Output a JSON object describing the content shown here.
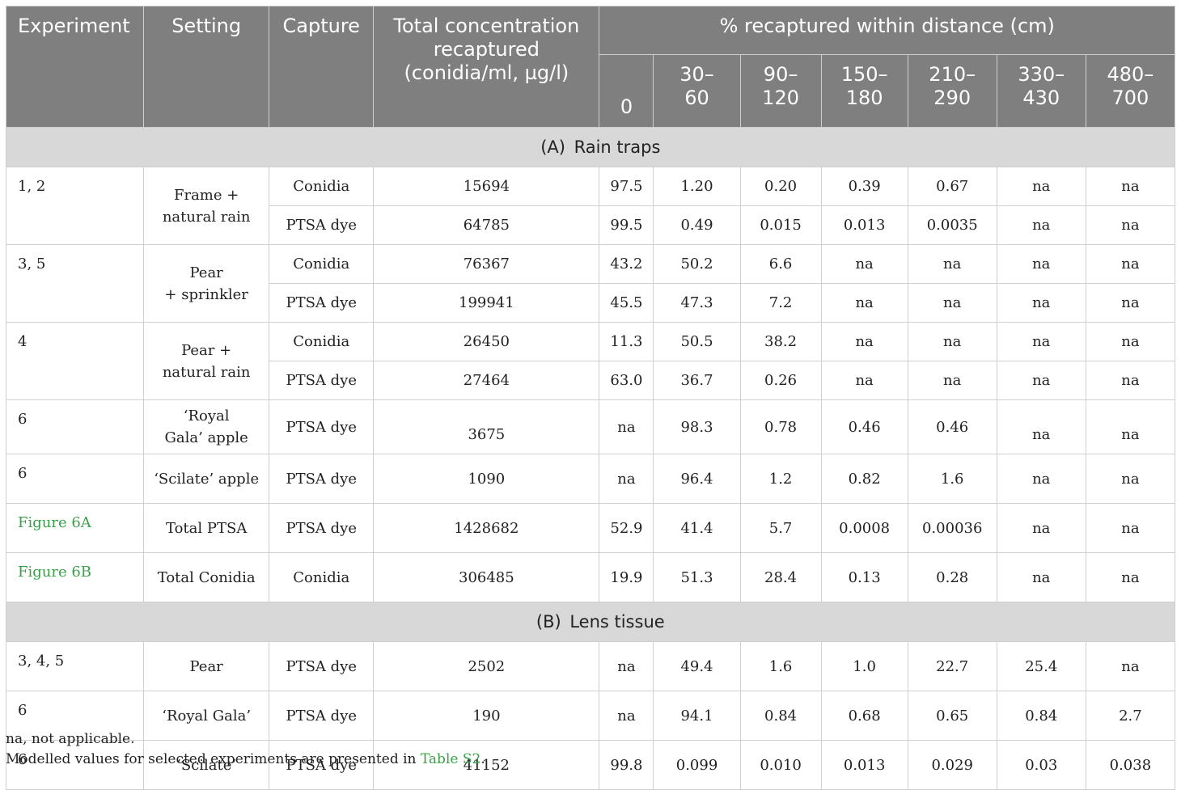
{
  "header": {
    "experiment": "Experiment",
    "setting": "Setting",
    "capture": "Capture",
    "total_line1": "Total concentration",
    "total_line2": "recaptured",
    "total_line3": "(conidia/ml, µg/l)",
    "distance_title": "% recaptured within distance (cm)",
    "distances": [
      [
        "0"
      ],
      [
        "30–",
        "60"
      ],
      [
        "90–",
        "120"
      ],
      [
        "150–",
        "180"
      ],
      [
        "210–",
        "290"
      ],
      [
        "330–",
        "430"
      ],
      [
        "480–",
        "700"
      ]
    ]
  },
  "sections": {
    "a_letter": "(A)",
    "a_title": "Rain traps",
    "b_letter": "(B)",
    "b_title": "Lens tissue"
  },
  "rows": {
    "e12": {
      "experiment": "1, 2",
      "setting_line1": "Frame +",
      "setting_line2": "natural rain",
      "conidia": [
        "Conidia",
        "15694",
        "97.5",
        "1.20",
        "0.20",
        "0.39",
        "0.67",
        "na",
        "na"
      ],
      "dye": [
        "PTSA dye",
        "64785",
        "99.5",
        "0.49",
        "0.015",
        "0.013",
        "0.0035",
        "na",
        "na"
      ]
    },
    "e35": {
      "experiment": "3, 5",
      "setting_line1": "Pear",
      "setting_line2": "+ sprinkler",
      "conidia": [
        "Conidia",
        "76367",
        "43.2",
        "50.2",
        "6.6",
        "na",
        "na",
        "na",
        "na"
      ],
      "dye": [
        "PTSA dye",
        "199941",
        "45.5",
        "47.3",
        "7.2",
        "na",
        "na",
        "na",
        "na"
      ]
    },
    "e4": {
      "experiment": "4",
      "setting_line1": "Pear +",
      "setting_line2": "natural rain",
      "conidia": [
        "Conidia",
        "26450",
        "11.3",
        "50.5",
        "38.2",
        "na",
        "na",
        "na",
        "na"
      ],
      "dye": [
        "PTSA dye",
        "27464",
        "63.0",
        "36.7",
        "0.26",
        "na",
        "na",
        "na",
        "na"
      ]
    },
    "e6_royal_gala_apple": {
      "experiment": "6",
      "setting_line1": "‘Royal",
      "setting_line2": "Gala’ apple",
      "cells": [
        "PTSA dye",
        "3675",
        "na",
        "98.3",
        "0.78",
        "0.46",
        "0.46",
        "na",
        "na"
      ]
    },
    "e6_scilate_apple": {
      "experiment": "6",
      "setting": "‘Scilate’ apple",
      "cells": [
        "PTSA dye",
        "1090",
        "na",
        "96.4",
        "1.2",
        "0.82",
        "1.6",
        "na",
        "na"
      ]
    },
    "fig6a": {
      "experiment": "Figure 6A",
      "setting": "Total PTSA",
      "cells": [
        "PTSA dye",
        "1428682",
        "52.9",
        "41.4",
        "5.7",
        "0.0008",
        "0.00036",
        "na",
        "na"
      ]
    },
    "fig6b": {
      "experiment": "Figure 6B",
      "setting": "Total Conidia",
      "cells": [
        "Conidia",
        "306485",
        "19.9",
        "51.3",
        "28.4",
        "0.13",
        "0.28",
        "na",
        "na"
      ]
    },
    "b_pear": {
      "experiment": "3, 4, 5",
      "setting": "Pear",
      "cells": [
        "PTSA dye",
        "2502",
        "na",
        "49.4",
        "1.6",
        "1.0",
        "22.7",
        "25.4",
        "na"
      ]
    },
    "b_royal_gala": {
      "experiment": "6",
      "setting": "‘Royal Gala’",
      "cells": [
        "PTSA dye",
        "190",
        "na",
        "94.1",
        "0.84",
        "0.68",
        "0.65",
        "0.84",
        "2.7"
      ]
    },
    "b_scilate": {
      "experiment": "6",
      "setting": "‘Scilate’",
      "cells": [
        "PTSA dye",
        "41152",
        "99.8",
        "0.099",
        "0.010",
        "0.013",
        "0.029",
        "0.03",
        "0.038"
      ]
    }
  },
  "footnotes": {
    "na_note": "na, not applicable.",
    "modelled_prefix": "Modelled values for selected experiments are presented in ",
    "modelled_link": "Table S2",
    "modelled_suffix": "."
  },
  "colors": {
    "header_bg": "#7f7f7f",
    "section_bg": "#d8d8d8",
    "link": "#3aa14a"
  }
}
